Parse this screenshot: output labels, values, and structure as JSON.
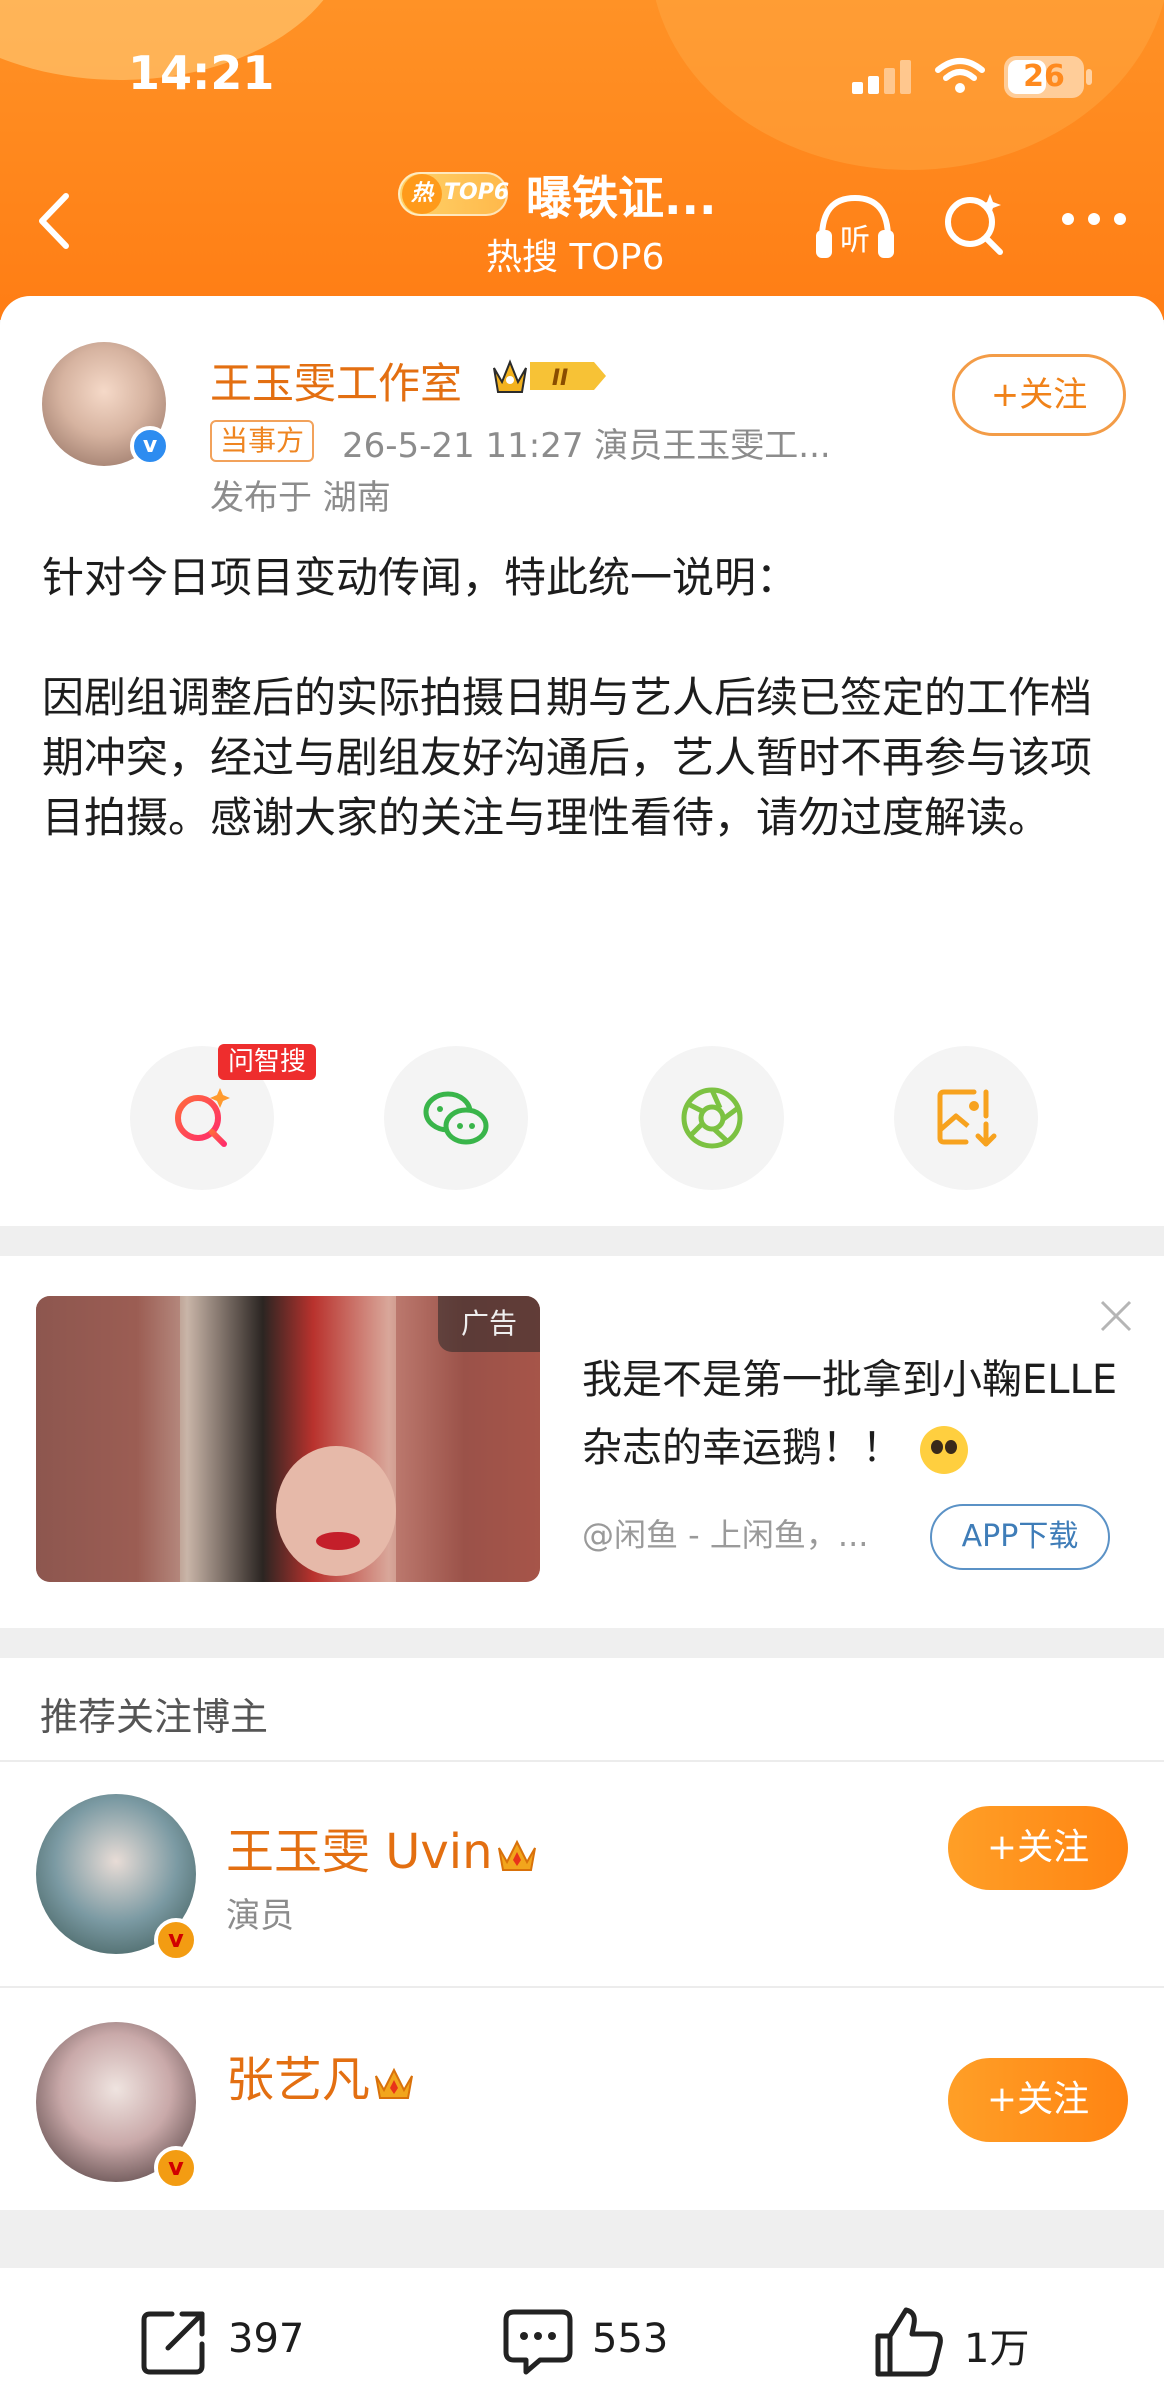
{
  "status_bar": {
    "time": "14:21",
    "battery": "26"
  },
  "header": {
    "badge_re": "热",
    "badge_top": "TOP6",
    "title": "曝铁证...",
    "subtitle": "热搜 TOP6"
  },
  "post": {
    "author": "王玉雯工作室",
    "vip_level": "II",
    "follow_label": "+关注",
    "tag": "当事方",
    "meta": "26-5-21 11:27  演员王玉雯工...",
    "location": "发布于 湖南",
    "paragraph1": "针对今日项目变动传闻，特此统一说明：",
    "paragraph2": "因剧组调整后的实际拍摄日期与艺人后续已签定的工作档期冲突，经过与剧组友好沟通后，艺人暂时不再参与该项目拍摄。感谢大家的关注与理性看待，请勿过度解读。",
    "wenzhisou_label": "问智搜"
  },
  "ad": {
    "label": "广告",
    "title": "我是不是第一批拿到小鞠ELLE杂志的幸运鹅！！",
    "source": "@闲鱼 - 上闲鱼，...",
    "app_button": "APP下载"
  },
  "recommend": {
    "title": "推荐关注博主",
    "users": [
      {
        "name": "王玉雯 Uvin",
        "desc": "演员",
        "follow_label": "+关注"
      },
      {
        "name": "张艺凡",
        "desc": "",
        "follow_label": "+关注"
      }
    ]
  },
  "bottom": {
    "repost": "397",
    "comment": "553",
    "like": "1万"
  },
  "colors": {
    "brand_orange": "#ff8a1e",
    "name_orange": "#e36f11",
    "verified_blue": "#2d8cf0"
  }
}
